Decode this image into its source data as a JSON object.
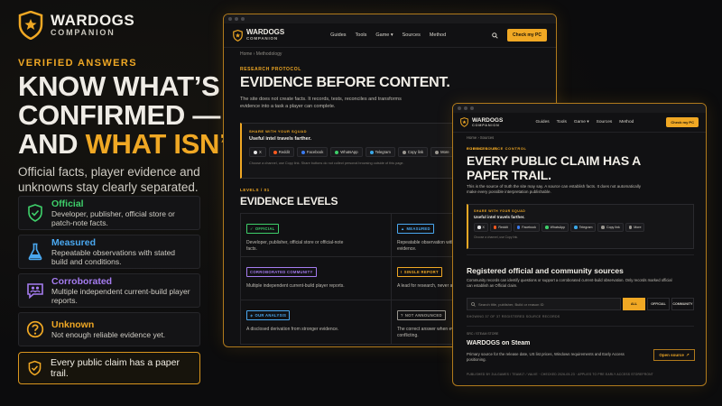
{
  "brand": {
    "name": "WARDOGS",
    "sub": "COMPANION"
  },
  "hero": {
    "eyebrow": "VERIFIED ANSWERS",
    "line1": "KNOW WHAT’S",
    "line2": "CONFIRMED —",
    "line3a": "AND ",
    "line3b": "WHAT ISN’T.",
    "subcopy": "Official facts, player evidence and unknowns stay clearly separated."
  },
  "statuses": [
    {
      "title": "Official",
      "desc": "Developer, publisher, official store or patch-note facts.",
      "color": "#3ecf6a",
      "icon": "shield-check-icon"
    },
    {
      "title": "Measured",
      "desc": "Repeatable observations with stated build and conditions.",
      "color": "#4aa8f0",
      "icon": "flask-icon"
    },
    {
      "title": "Corroborated",
      "desc": "Multiple independent current-build player reports.",
      "color": "#a57cf0",
      "icon": "chat-users-icon"
    },
    {
      "title": "Unknown",
      "desc": "Not enough reliable evidence yet.",
      "color": "#f0a824",
      "icon": "question-circle-icon"
    }
  ],
  "paper_trail": "Every public claim has a paper trail.",
  "accent": "#f0a824",
  "win1": {
    "nav": [
      "Guides",
      "Tools",
      "Game ▾",
      "Sources",
      "Method"
    ],
    "cta": "Check my PC",
    "crumb": "Home  ›  Methodology",
    "kicker": "RESEARCH PROTOCOL",
    "title": "EVIDENCE BEFORE CONTENT.",
    "body": "The site does not create facts. It records, tests, reconciles and transforms evidence into a task a player can complete.",
    "share_k": "SHARE WITH YOUR SQUAD",
    "share_t": "Useful intel travels farther.",
    "chips": [
      {
        "label": "X",
        "color": "#e6e6e6"
      },
      {
        "label": "Reddit",
        "color": "#ff5a1f"
      },
      {
        "label": "Facebook",
        "color": "#3b7bf0"
      },
      {
        "label": "WhatsApp",
        "color": "#3ecf6a"
      },
      {
        "label": "Telegram",
        "color": "#3aa8e8"
      },
      {
        "label": "Copy link",
        "color": "#9a9790"
      },
      {
        "label": "More",
        "color": "#9a9790"
      }
    ],
    "share_note": "Choose a channel, use Copy link. Share buttons do not collect personal browsing outside of this page.",
    "levels_k": "LEVELS / 01",
    "levels_h": "EVIDENCE LEVELS",
    "levels": [
      {
        "badge": "OFFICIAL",
        "color": "#3ecf6a",
        "desc": "Developer, publisher, official store or official-note facts."
      },
      {
        "badge": "MEASURED",
        "color": "#4aa8f0",
        "desc": "Repeatable observation with build, conditions and evidence."
      },
      {
        "badge": "CORROBORATED COMMUNITY",
        "color": "#a57cf0",
        "desc": "Multiple independent current-build player reports."
      },
      {
        "badge": "SINGLE REPORT",
        "color": "#f0a824",
        "desc": "A lead for research, never a community consensus."
      },
      {
        "badge": "OUR ANALYSIS",
        "color": "#4aa8f0",
        "desc": "A disclosed derivation from stronger evidence."
      },
      {
        "badge": "NOT ANNOUNCED",
        "color": "#9a9790",
        "desc": "The correct answer when evidence is absent or conflicting."
      }
    ]
  },
  "win2": {
    "nav": [
      "Guides",
      "Tools",
      "Game ▾",
      "Sources",
      "Method"
    ],
    "cta": "Check my PC",
    "crumb": "Home  ›  Sources",
    "kicker": "PUBLIC SOURCE CONTROL",
    "title": "EVERY PUBLIC CLAIM HAS A PAPER TRAIL.",
    "body": "This is the source of truth the site may say. A source can establish facts. It does not automatically make every possible interpretation publishable.",
    "share_k": "SHARE WITH YOUR SQUAD",
    "share_t": "Useful intel travels farther.",
    "chips": [
      {
        "label": "X",
        "color": "#e6e6e6"
      },
      {
        "label": "Reddit",
        "color": "#ff5a1f"
      },
      {
        "label": "Facebook",
        "color": "#3b7bf0"
      },
      {
        "label": "WhatsApp",
        "color": "#3ecf6a"
      },
      {
        "label": "Telegram",
        "color": "#3aa8e8"
      },
      {
        "label": "Copy link",
        "color": "#9a9790"
      },
      {
        "label": "More",
        "color": "#9a9790"
      }
    ],
    "share_note": "Choose a channel, use Copy link.",
    "sources_k": "SOURCES / 01",
    "sources_h": "Registered official and community sources",
    "sources_body": "Community records can identify questions or support a corroborated current-build observation. Only records marked official can establish an Official claim.",
    "search_placeholder": "Search title, publisher, Build or reason ID",
    "filters": [
      "ALL",
      "OFFICIAL",
      "COMMUNITY"
    ],
    "count": "SHOWING 37 OF 37 REGISTERED SOURCE RECORDS",
    "entry_k": "SRC / STEAM STORE",
    "entry_h": "WARDOGS on Steam",
    "entry_b": "Primary source for the release date, US list prices, Windows requirements and Early Access positioning.",
    "open": "Open source",
    "entry_meta": "PUBLISHED BY 2ULGAMES / TEAM17 / VALVE · CHECKED 2026-05-23 · APPLIES TO PRE EARLY ACCESS STOREFRONT"
  }
}
